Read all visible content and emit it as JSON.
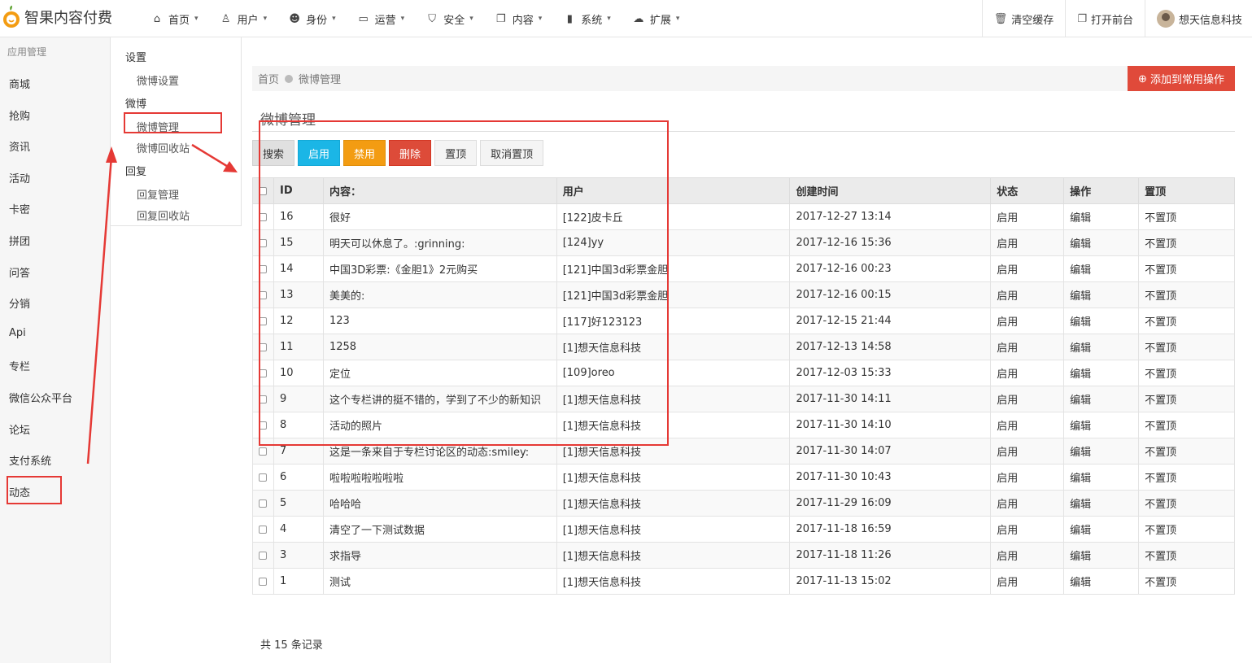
{
  "app": {
    "title": "智果内容付费"
  },
  "nav": [
    {
      "label": "首页",
      "icon": "home-icon"
    },
    {
      "label": "用户",
      "icon": "user-icon"
    },
    {
      "label": "身份",
      "icon": "users-icon"
    },
    {
      "label": "运营",
      "icon": "monitor-icon"
    },
    {
      "label": "安全",
      "icon": "shield-icon"
    },
    {
      "label": "内容",
      "icon": "copy-icon"
    },
    {
      "label": "系统",
      "icon": "grid-icon"
    },
    {
      "label": "扩展",
      "icon": "cloud-icon"
    }
  ],
  "top_right": {
    "clear_cache": "清空缓存",
    "open_front": "打开前台",
    "user_name": "想天信息科技"
  },
  "sidebar": {
    "heading": "应用管理",
    "items": [
      "商城",
      "抢购",
      "资讯",
      "活动",
      "卡密",
      "拼团",
      "问答",
      "分销",
      "Api",
      "专栏",
      "微信公众平台",
      "论坛",
      "支付系统",
      "动态"
    ]
  },
  "subnav": {
    "groups": [
      {
        "label": "设置",
        "items": [
          "微博设置"
        ]
      },
      {
        "label": "微博",
        "items": [
          "微博管理",
          "微博回收站"
        ]
      },
      {
        "label": "回复",
        "items": [
          "回复管理",
          "回复回收站"
        ]
      }
    ]
  },
  "breadcrumb": {
    "home": "首页",
    "current": "微博管理"
  },
  "add_button": "添加到常用操作",
  "page_title": "微博管理",
  "buttons": {
    "search": "搜索",
    "enable": "启用",
    "disable": "禁用",
    "delete": "删除",
    "top": "置顶",
    "untop": "取消置顶"
  },
  "table": {
    "headers": [
      "ID",
      "内容：",
      "用户",
      "创建时间",
      "状态",
      "操作",
      "置顶"
    ],
    "rows": [
      {
        "id": "16",
        "content": "很好",
        "user": "[122]皮卡丘",
        "time": "2017-12-27 13:14",
        "status": "启用",
        "action": "编辑",
        "top": "不置顶"
      },
      {
        "id": "15",
        "content": "明天可以休息了。:grinning:",
        "user": "[124]yy",
        "time": "2017-12-16 15:36",
        "status": "启用",
        "action": "编辑",
        "top": "不置顶"
      },
      {
        "id": "14",
        "content": "中国3D彩票:《金胆1》2元购买",
        "user": "[121]中国3d彩票金胆",
        "time": "2017-12-16 00:23",
        "status": "启用",
        "action": "编辑",
        "top": "不置顶"
      },
      {
        "id": "13",
        "content": "美美的:",
        "user": "[121]中国3d彩票金胆",
        "time": "2017-12-16 00:15",
        "status": "启用",
        "action": "编辑",
        "top": "不置顶"
      },
      {
        "id": "12",
        "content": "123",
        "user": "[117]好123123",
        "time": "2017-12-15 21:44",
        "status": "启用",
        "action": "编辑",
        "top": "不置顶"
      },
      {
        "id": "11",
        "content": "1258",
        "user": "[1]想天信息科技",
        "time": "2017-12-13 14:58",
        "status": "启用",
        "action": "编辑",
        "top": "不置顶"
      },
      {
        "id": "10",
        "content": "定位",
        "user": "[109]oreo",
        "time": "2017-12-03 15:33",
        "status": "启用",
        "action": "编辑",
        "top": "不置顶"
      },
      {
        "id": "9",
        "content": "这个专栏讲的挺不错的，学到了不少的新知识",
        "user": "[1]想天信息科技",
        "time": "2017-11-30 14:11",
        "status": "启用",
        "action": "编辑",
        "top": "不置顶"
      },
      {
        "id": "8",
        "content": "活动的照片",
        "user": "[1]想天信息科技",
        "time": "2017-11-30 14:10",
        "status": "启用",
        "action": "编辑",
        "top": "不置顶"
      },
      {
        "id": "7",
        "content": "这是一条来自于专栏讨论区的动态:smiley:",
        "user": "[1]想天信息科技",
        "time": "2017-11-30 14:07",
        "status": "启用",
        "action": "编辑",
        "top": "不置顶"
      },
      {
        "id": "6",
        "content": "啦啦啦啦啦啦啦",
        "user": "[1]想天信息科技",
        "time": "2017-11-30 10:43",
        "status": "启用",
        "action": "编辑",
        "top": "不置顶"
      },
      {
        "id": "5",
        "content": "哈哈哈",
        "user": "[1]想天信息科技",
        "time": "2017-11-29 16:09",
        "status": "启用",
        "action": "编辑",
        "top": "不置顶"
      },
      {
        "id": "4",
        "content": "清空了一下测试数据",
        "user": "[1]想天信息科技",
        "time": "2017-11-18 16:59",
        "status": "启用",
        "action": "编辑",
        "top": "不置顶"
      },
      {
        "id": "3",
        "content": "求指导",
        "user": "[1]想天信息科技",
        "time": "2017-11-18 11:26",
        "status": "启用",
        "action": "编辑",
        "top": "不置顶"
      },
      {
        "id": "1",
        "content": "测试",
        "user": "[1]想天信息科技",
        "time": "2017-11-13 15:02",
        "status": "启用",
        "action": "编辑",
        "top": "不置顶"
      }
    ]
  },
  "footer": {
    "count": "共 15 条记录"
  }
}
